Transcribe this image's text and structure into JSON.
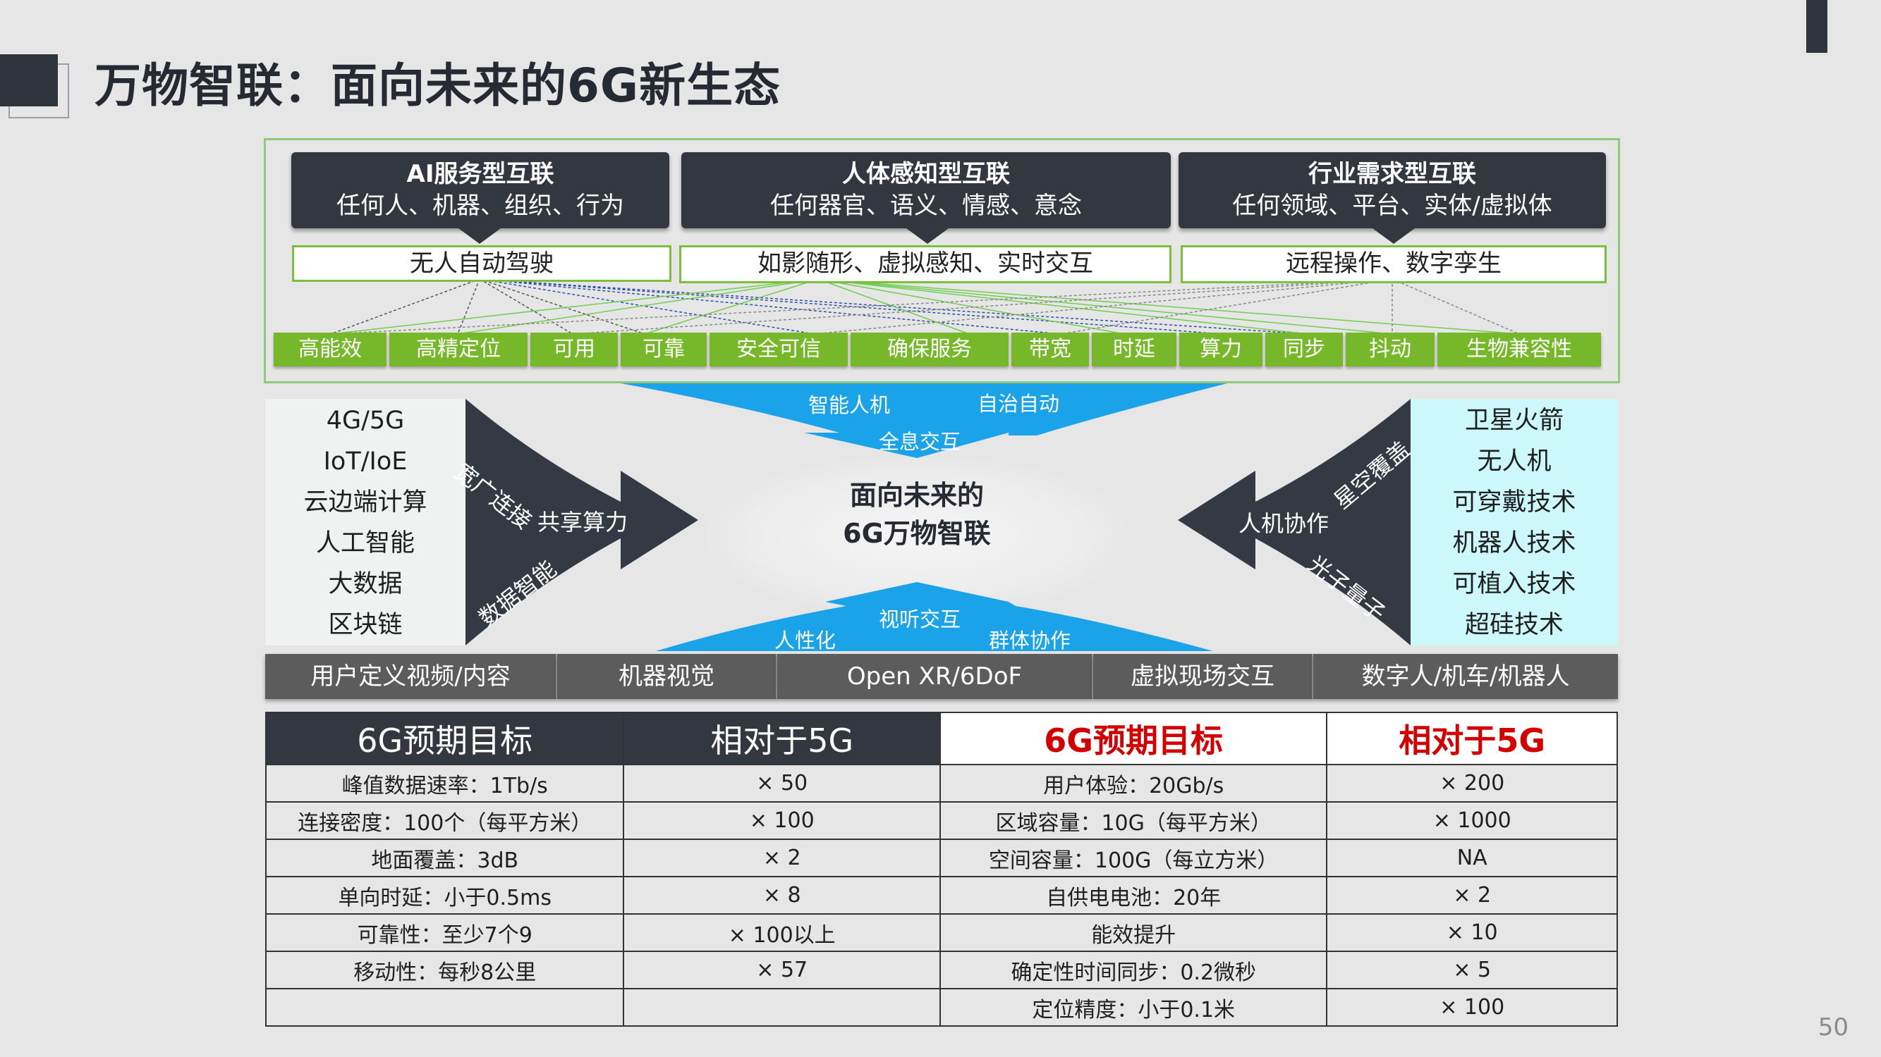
{
  "title": "万物智联：面向未来的6G新生态",
  "page_number": "50",
  "cards": [
    {
      "title": "AI服务型互联",
      "subtitle": "任何人、机器、组织、行为",
      "box": "无人自动驾驶"
    },
    {
      "title": "人体感知型互联",
      "subtitle": "任何器官、语义、情感、意念",
      "box": "如影随形、虚拟感知、实时交互"
    },
    {
      "title": "行业需求型互联",
      "subtitle": "任何领域、平台、实体/虚拟体",
      "box": "远程操作、数字孪生"
    }
  ],
  "pills": [
    "高能效",
    "高精定位",
    "可用",
    "可靠",
    "安全可信",
    "确保服务",
    "带宽",
    "时延",
    "算力",
    "同步",
    "抖动",
    "生物兼容性"
  ],
  "left_list": [
    "4G/5G",
    "IoT/IoE",
    "云边端计算",
    "人工智能",
    "大数据",
    "区块链"
  ],
  "right_list": [
    "卫星火箭",
    "无人机",
    "可穿戴技术",
    "机器人技术",
    "可植入技术",
    "超硅技术"
  ],
  "left_arrow": {
    "top": "宽广连接",
    "middle": "共享算力",
    "bottom": "数据智能"
  },
  "right_arrow": {
    "top": "星空覆盖",
    "middle": "人机协作",
    "bottom": "光子量子"
  },
  "top_arrow": {
    "left": "智能人机",
    "right": "自治自动",
    "center": "全息交互"
  },
  "bottom_arrow": {
    "center": "视听交互",
    "left": "人性化",
    "right": "群体协作"
  },
  "center_title": [
    "面向未来的",
    "6G万物智联"
  ],
  "scenarios": [
    "用户定义视频/内容",
    "机器视觉",
    "Open XR/6DoF",
    "虚拟现场交互",
    "数字人/机车/机器人"
  ],
  "table": {
    "headers": [
      "6G预期目标",
      "相对于5G",
      "6G预期目标",
      "相对于5G"
    ],
    "rows": [
      [
        "峰值数据速率：1Tb/s",
        "× 50",
        "用户体验：20Gb/s",
        "× 200"
      ],
      [
        "连接密度：100个（每平方米）",
        "× 100",
        "区域容量：10G（每平方米）",
        "× 1000"
      ],
      [
        "地面覆盖：3dB",
        "× 2",
        "空间容量：100G（每立方米）",
        "NA"
      ],
      [
        "单向时延：小于0.5ms",
        "× 8",
        "自供电电池：20年",
        "× 2"
      ],
      [
        "可靠性：至少7个9",
        "× 100以上",
        "能效提升",
        "× 10"
      ],
      [
        "移动性：每秒8公里",
        "× 57",
        "确定性时间同步：0.2微秒",
        "× 5"
      ],
      [
        "",
        "",
        "定位精度：小于0.1米",
        "× 100"
      ]
    ]
  },
  "colors": {
    "dark": "#33373f",
    "green": "#76b82a",
    "cyan": "#1aa3e8",
    "red": "#d40000",
    "light_cyan": "#ccf7fb"
  }
}
